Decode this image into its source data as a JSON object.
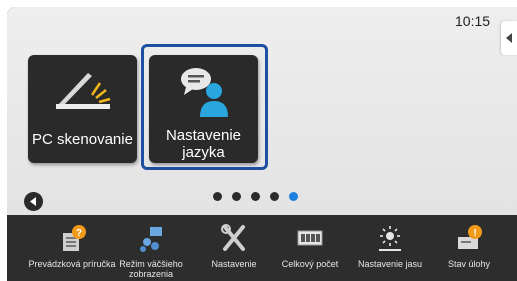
{
  "status": {
    "time": "10:15"
  },
  "tiles": [
    {
      "label": "PC skenovanie",
      "icon": "scanner-icon"
    },
    {
      "label": "Nastavenie jazyka",
      "icon": "language-user-icon"
    }
  ],
  "pager": {
    "count": 5,
    "active_index": 4
  },
  "taskbar": [
    {
      "label": "Prevádzková príručka",
      "icon": "guide-book-icon"
    },
    {
      "label": "Režim väčšieho zobrazenia",
      "icon": "large-display-icon"
    },
    {
      "label": "Nastavenie",
      "icon": "tools-icon"
    },
    {
      "label": "Celkový počet",
      "icon": "counter-icon"
    },
    {
      "label": "Nastavenie jasu",
      "icon": "brightness-icon"
    },
    {
      "label": "Stav úlohy",
      "icon": "job-status-icon"
    }
  ],
  "colors": {
    "focus_ring": "#1e4fa0",
    "active_dot": "#1d7fe0",
    "tile_bg": "#2a2a2a",
    "taskbar_bg": "#2d2d2d"
  }
}
